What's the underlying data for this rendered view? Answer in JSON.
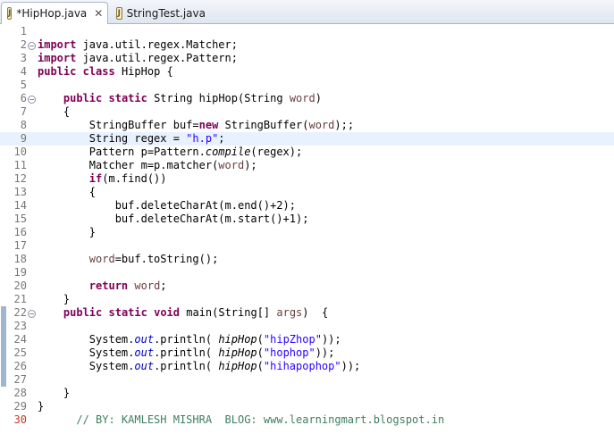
{
  "tabs": [
    {
      "label": "*HipHop.java",
      "close": "✕",
      "icon": "java-file-icon"
    },
    {
      "label": "StringTest.java",
      "icon": "java-file-icon"
    }
  ],
  "lines": [
    {
      "n": "1",
      "tokens": []
    },
    {
      "n": "2",
      "fold": "−",
      "tokens": [
        {
          "t": "import",
          "c": "kw"
        },
        {
          "t": " java.util.regex.Matcher;"
        }
      ]
    },
    {
      "n": "3",
      "tokens": [
        {
          "t": "import",
          "c": "kw"
        },
        {
          "t": " java.util.regex.Pattern;"
        }
      ]
    },
    {
      "n": "4",
      "tokens": [
        {
          "t": "public",
          "c": "kw"
        },
        {
          "t": " "
        },
        {
          "t": "class",
          "c": "kw"
        },
        {
          "t": " HipHop {"
        }
      ]
    },
    {
      "n": "5",
      "tokens": []
    },
    {
      "n": "6",
      "fold": "−",
      "tokens": [
        {
          "t": "    "
        },
        {
          "t": "public",
          "c": "kw"
        },
        {
          "t": " "
        },
        {
          "t": "static",
          "c": "kw"
        },
        {
          "t": " String hipHop(String "
        },
        {
          "t": "word",
          "c": "param"
        },
        {
          "t": ")"
        }
      ]
    },
    {
      "n": "7",
      "tokens": [
        {
          "t": "    {"
        }
      ]
    },
    {
      "n": "8",
      "tokens": [
        {
          "t": "        StringBuffer buf="
        },
        {
          "t": "new",
          "c": "kw"
        },
        {
          "t": " StringBuffer("
        },
        {
          "t": "word",
          "c": "param"
        },
        {
          "t": ");;"
        }
      ]
    },
    {
      "n": "9",
      "current": true,
      "tokens": [
        {
          "t": "        String regex = "
        },
        {
          "t": "\"h.p\"",
          "c": "str"
        },
        {
          "t": ";"
        }
      ]
    },
    {
      "n": "10",
      "tokens": [
        {
          "t": "        Pattern p=Pattern."
        },
        {
          "t": "compile",
          "c": "ital"
        },
        {
          "t": "(regex);"
        }
      ]
    },
    {
      "n": "11",
      "tokens": [
        {
          "t": "        Matcher m=p.matcher("
        },
        {
          "t": "word",
          "c": "param"
        },
        {
          "t": ");"
        }
      ]
    },
    {
      "n": "12",
      "tokens": [
        {
          "t": "        "
        },
        {
          "t": "if",
          "c": "kw"
        },
        {
          "t": "(m.find())"
        }
      ]
    },
    {
      "n": "13",
      "tokens": [
        {
          "t": "        {"
        }
      ]
    },
    {
      "n": "14",
      "tokens": [
        {
          "t": "            buf.deleteCharAt(m.end()+2);"
        }
      ]
    },
    {
      "n": "15",
      "tokens": [
        {
          "t": "            buf.deleteCharAt(m.start()+1);"
        }
      ]
    },
    {
      "n": "16",
      "tokens": [
        {
          "t": "        }"
        }
      ]
    },
    {
      "n": "17",
      "tokens": []
    },
    {
      "n": "18",
      "tokens": [
        {
          "t": "        "
        },
        {
          "t": "word",
          "c": "param"
        },
        {
          "t": "=buf.toString();"
        }
      ]
    },
    {
      "n": "19",
      "tokens": []
    },
    {
      "n": "20",
      "tokens": [
        {
          "t": "        "
        },
        {
          "t": "return",
          "c": "kw"
        },
        {
          "t": " "
        },
        {
          "t": "word",
          "c": "param"
        },
        {
          "t": ";"
        }
      ]
    },
    {
      "n": "21",
      "tokens": [
        {
          "t": "    }"
        }
      ]
    },
    {
      "n": "22",
      "fold": "−",
      "marker": true,
      "tokens": [
        {
          "t": "    "
        },
        {
          "t": "public",
          "c": "kw"
        },
        {
          "t": " "
        },
        {
          "t": "static",
          "c": "kw"
        },
        {
          "t": " "
        },
        {
          "t": "void",
          "c": "kw"
        },
        {
          "t": " main(String[] "
        },
        {
          "t": "args",
          "c": "param"
        },
        {
          "t": ")  {"
        }
      ]
    },
    {
      "n": "23",
      "marker": true,
      "tokens": []
    },
    {
      "n": "24",
      "marker": true,
      "tokens": [
        {
          "t": "        System."
        },
        {
          "t": "out",
          "c": "fld"
        },
        {
          "t": ".println( "
        },
        {
          "t": "hipHop",
          "c": "ital"
        },
        {
          "t": "("
        },
        {
          "t": "\"hipZhop\"",
          "c": "str"
        },
        {
          "t": "));"
        }
      ]
    },
    {
      "n": "25",
      "marker": true,
      "tokens": [
        {
          "t": "        System."
        },
        {
          "t": "out",
          "c": "fld"
        },
        {
          "t": ".println( "
        },
        {
          "t": "hipHop",
          "c": "ital"
        },
        {
          "t": "("
        },
        {
          "t": "\"hophop\"",
          "c": "str"
        },
        {
          "t": "));"
        }
      ]
    },
    {
      "n": "26",
      "marker": true,
      "tokens": [
        {
          "t": "        System."
        },
        {
          "t": "out",
          "c": "fld"
        },
        {
          "t": ".println( "
        },
        {
          "t": "hipHop",
          "c": "ital"
        },
        {
          "t": "("
        },
        {
          "t": "\"hihapophop\"",
          "c": "str"
        },
        {
          "t": "));"
        }
      ]
    },
    {
      "n": "27",
      "marker": true,
      "tokens": []
    },
    {
      "n": "28",
      "tokens": [
        {
          "t": "    }"
        }
      ]
    },
    {
      "n": "29",
      "tokens": [
        {
          "t": "}"
        }
      ]
    },
    {
      "n": "30",
      "mark": true,
      "tokens": [
        {
          "t": "      "
        },
        {
          "t": "// BY: KAMLESH MISHRA  BLOG: www.learningmart.blogspot.in",
          "c": "cmt"
        }
      ]
    }
  ],
  "colors": {
    "keyword": "#7f0055",
    "string": "#2a00ff",
    "comment": "#3f7f5f",
    "field": "#0000c0",
    "current_line": "#e8f2fe"
  }
}
